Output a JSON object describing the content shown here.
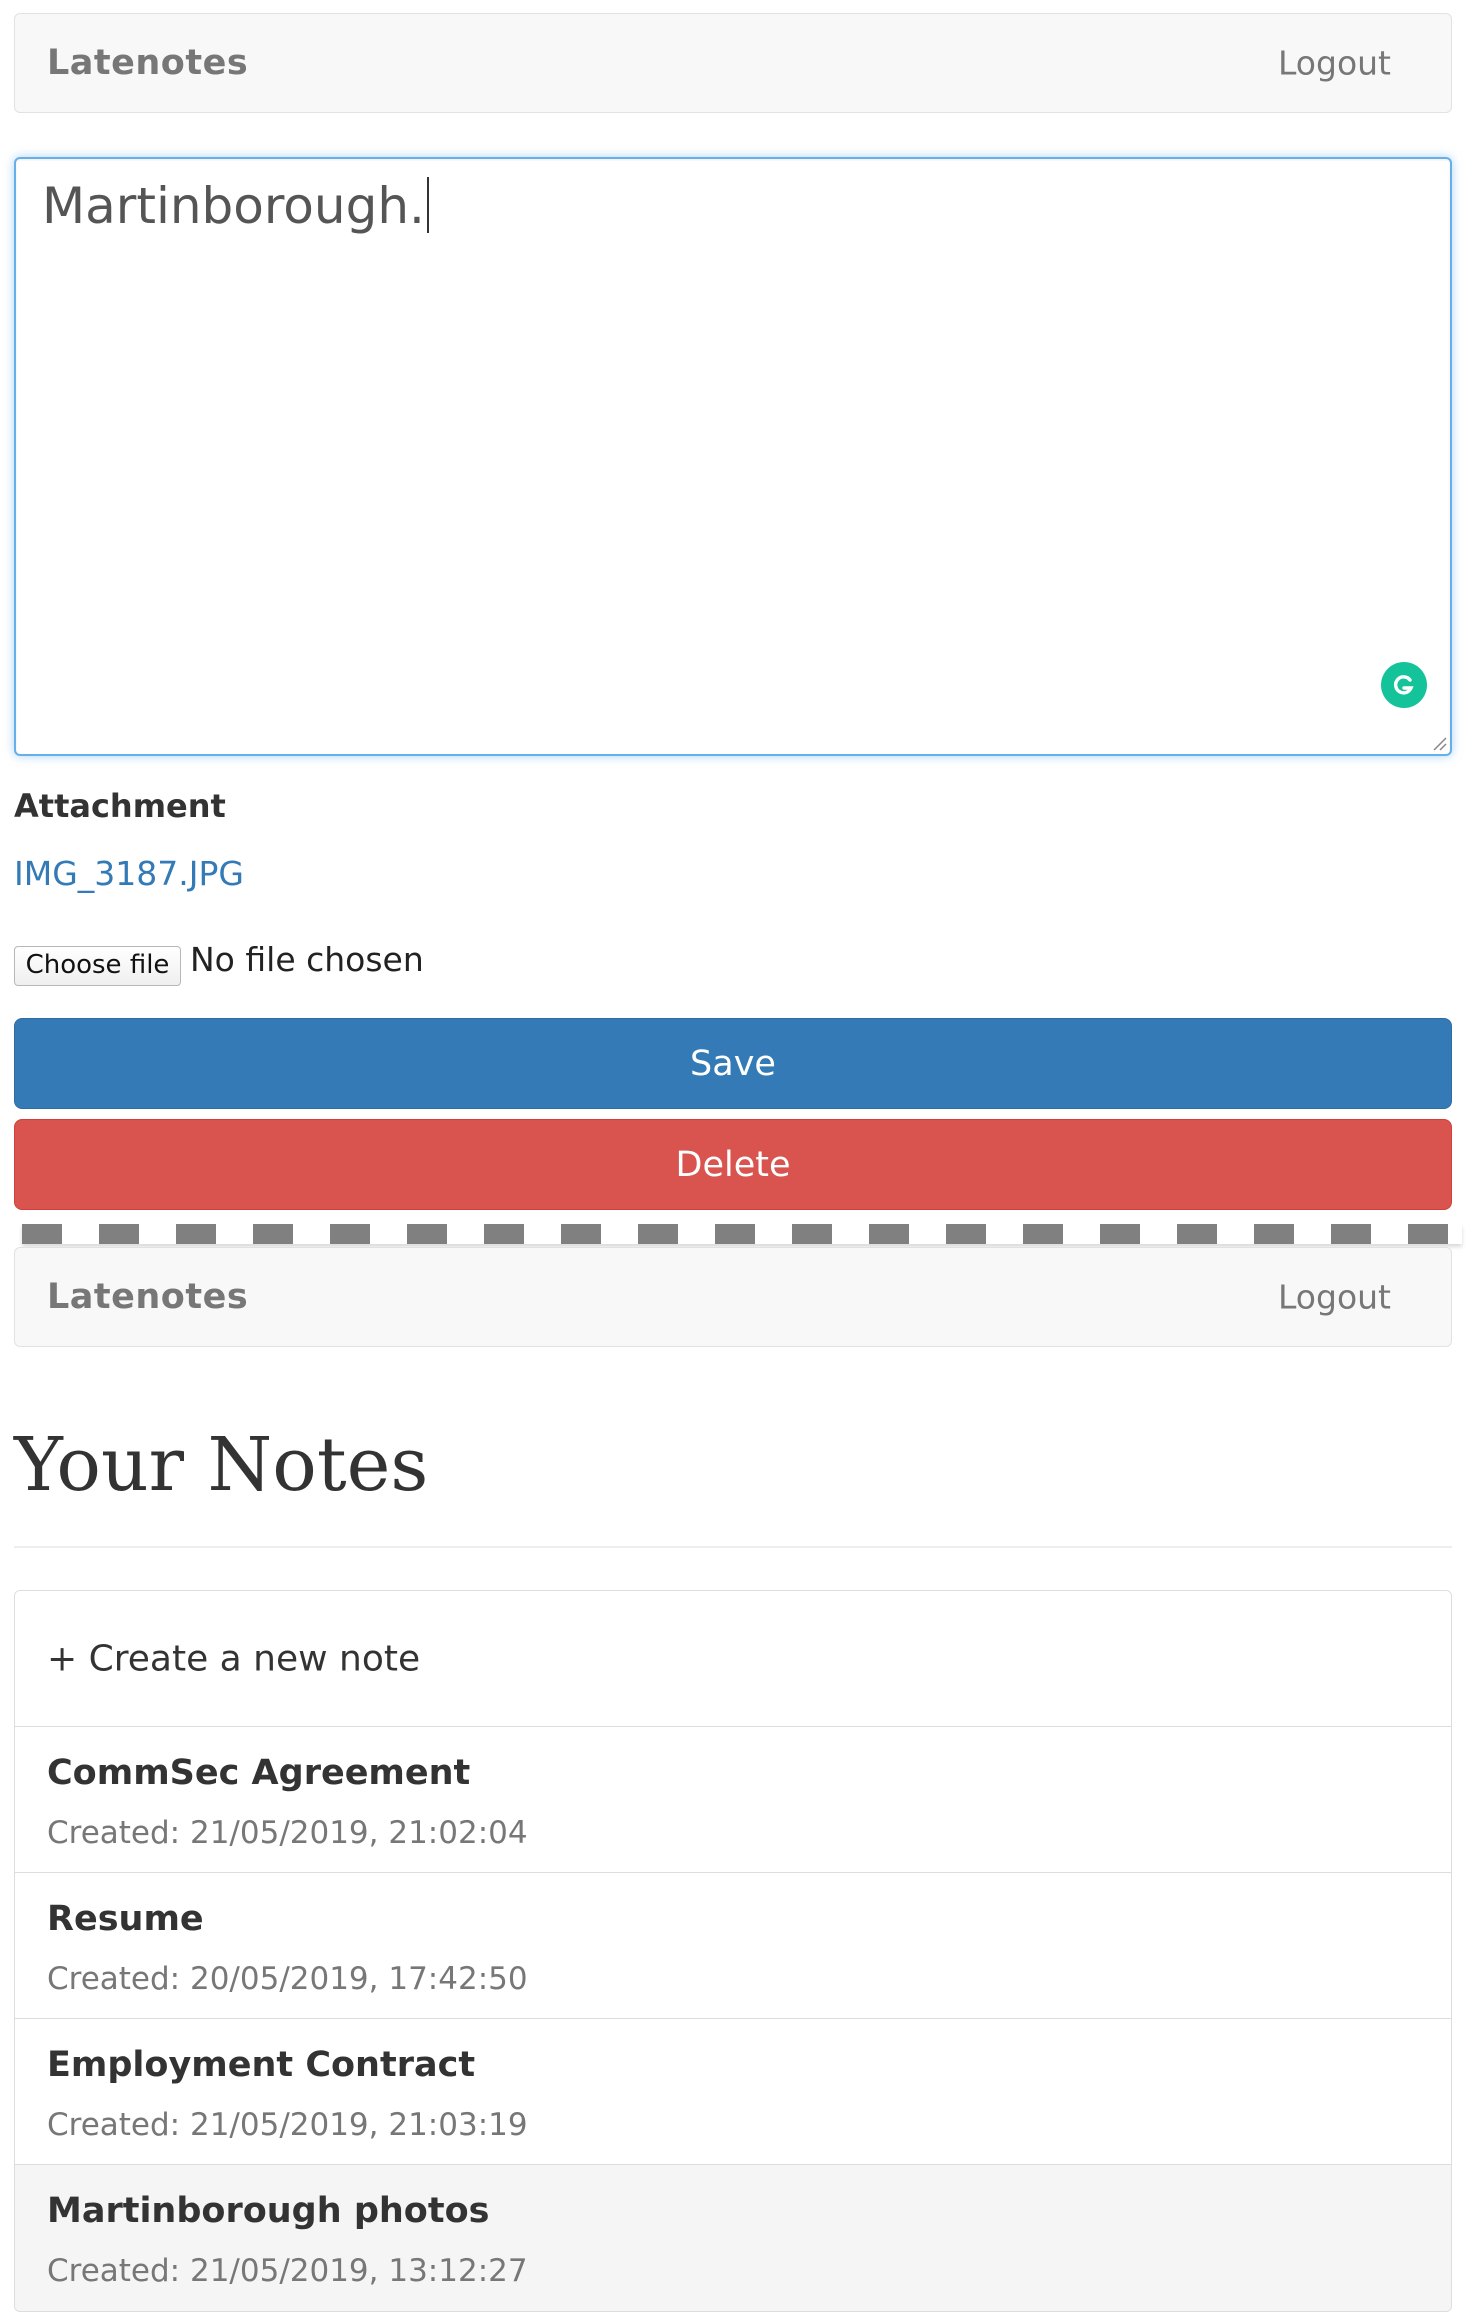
{
  "navbar": {
    "brand": "Latenotes",
    "logout": "Logout"
  },
  "editor": {
    "content": "Martinborough."
  },
  "attachment": {
    "label": "Attachment",
    "file_link": "IMG_3187.JPG",
    "choose_button": "Choose file",
    "file_status": "No file chosen"
  },
  "actions": {
    "save": "Save",
    "delete": "Delete"
  },
  "notes_page": {
    "title": "Your Notes",
    "create_new": "+ Create a new note",
    "notes": [
      {
        "title": "CommSec Agreement",
        "created": "Created: 21/05/2019, 21:02:04"
      },
      {
        "title": "Resume",
        "created": "Created: 20/05/2019, 17:42:50"
      },
      {
        "title": "Employment Contract",
        "created": "Created: 21/05/2019, 21:03:19"
      },
      {
        "title": "Martinborough photos",
        "created": "Created: 21/05/2019, 13:12:27"
      }
    ]
  },
  "colors": {
    "primary": "#337ab7",
    "danger": "#d9534f",
    "grammarly": "#15c39a"
  }
}
